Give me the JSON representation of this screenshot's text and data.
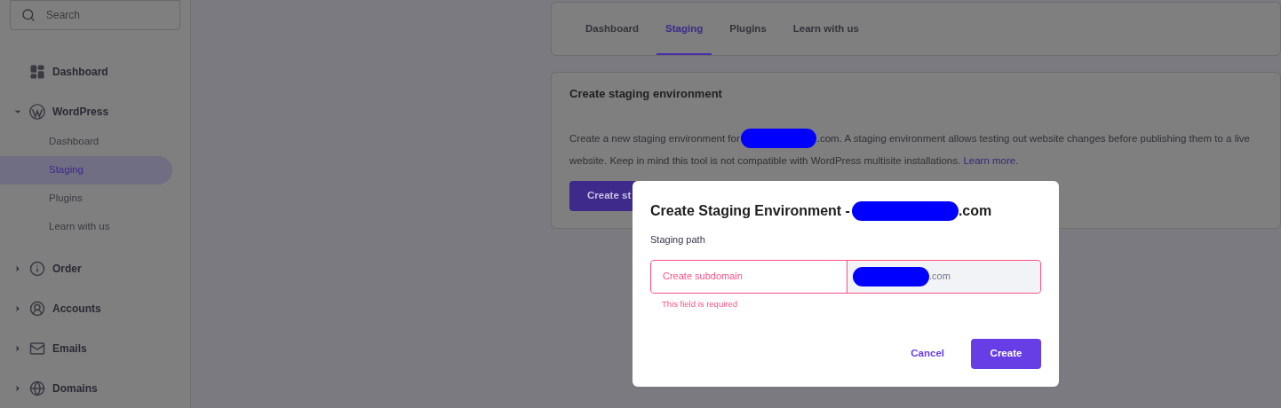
{
  "sidebar": {
    "search": {
      "placeholder": "Search"
    },
    "items": [
      {
        "label": "Dashboard"
      },
      {
        "label": "WordPress",
        "expanded": true,
        "children": [
          {
            "label": "Dashboard",
            "selected": false
          },
          {
            "label": "Staging",
            "selected": true
          },
          {
            "label": "Plugins",
            "selected": false
          },
          {
            "label": "Learn with us",
            "selected": false
          }
        ]
      },
      {
        "label": "Order",
        "expanded": false
      },
      {
        "label": "Accounts",
        "expanded": false
      },
      {
        "label": "Emails",
        "expanded": false
      },
      {
        "label": "Domains",
        "expanded": false
      }
    ]
  },
  "tabs": [
    {
      "label": "Dashboard",
      "selected": false
    },
    {
      "label": "Staging",
      "selected": true
    },
    {
      "label": "Plugins",
      "selected": false
    },
    {
      "label": "Learn with us",
      "selected": false
    }
  ],
  "card": {
    "title": "Create staging environment",
    "text_before": "Create a new staging environment for",
    "text_after": ".com. A staging environment allows testing out website changes before publishing them to a live website. Keep in mind this tool is not compatible with WordPress multisite installations.",
    "link": "Learn more",
    "link_after": ".",
    "button": "Create st"
  },
  "dialog": {
    "title": "Create Staging Environment -",
    "title_suffix": ".com",
    "field_label": "Staging path",
    "subdomain": {
      "placeholder": "Create subdomain",
      "invalid": true
    },
    "domain_suffix": ".com",
    "error": "This field is required",
    "buttons": [
      {
        "label": "Cancel",
        "kind": "text"
      },
      {
        "label": "Create",
        "kind": "primary"
      }
    ]
  }
}
